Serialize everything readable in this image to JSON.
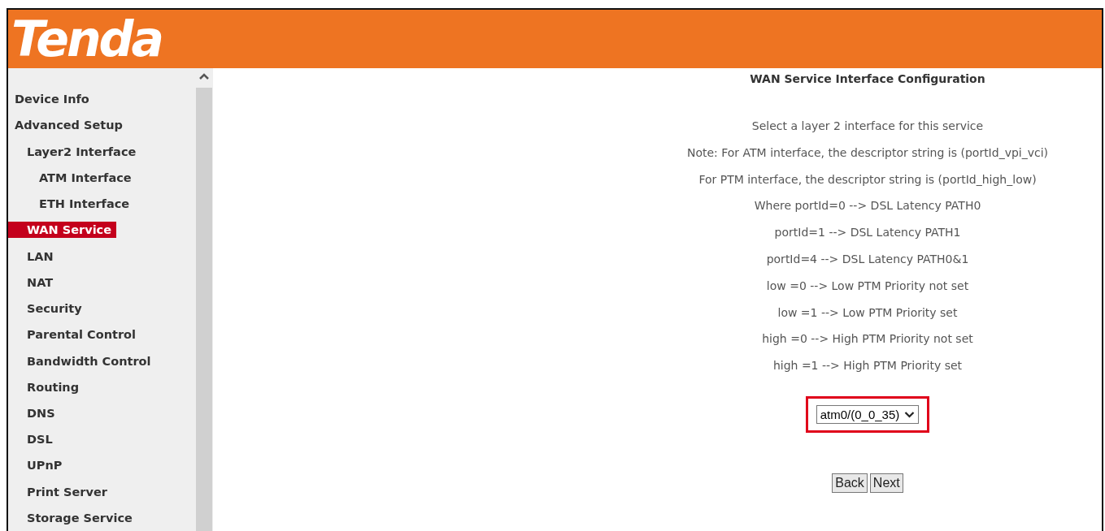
{
  "header": {
    "logo": "Tenda"
  },
  "sidebar": {
    "items": [
      {
        "label": "Device Info",
        "selected": false
      },
      {
        "label": "Advanced Setup",
        "selected": false,
        "children": [
          {
            "label": "Layer2 Interface",
            "selected": false,
            "children": [
              {
                "label": "ATM Interface",
                "selected": false
              },
              {
                "label": "ETH Interface",
                "selected": false
              }
            ]
          },
          {
            "label": "WAN Service",
            "selected": true
          },
          {
            "label": "LAN",
            "selected": false
          },
          {
            "label": "NAT",
            "selected": false
          },
          {
            "label": "Security",
            "selected": false
          },
          {
            "label": "Parental Control",
            "selected": false
          },
          {
            "label": "Bandwidth Control",
            "selected": false
          },
          {
            "label": "Routing",
            "selected": false
          },
          {
            "label": "DNS",
            "selected": false
          },
          {
            "label": "DSL",
            "selected": false
          },
          {
            "label": "UPnP",
            "selected": false
          },
          {
            "label": "Print Server",
            "selected": false
          },
          {
            "label": "Storage Service",
            "selected": false
          }
        ]
      }
    ]
  },
  "content": {
    "title": "WAN Service Interface Configuration",
    "notes": [
      "Select a layer 2 interface for this service",
      "Note: For ATM interface, the descriptor string is (portId_vpi_vci)",
      "For PTM interface, the descriptor string is (portId_high_low)",
      "Where portId=0 --> DSL Latency PATH0",
      "portId=1 --> DSL Latency PATH1",
      "portId=4 --> DSL Latency PATH0&1",
      "low =0 --> Low PTM Priority not set",
      "low =1 --> Low PTM Priority set",
      "high =0 --> High PTM Priority not set",
      "high =1 --> High PTM Priority set"
    ],
    "interface_select": {
      "value": "atm0/(0_0_35)",
      "highlighted": true
    },
    "buttons": [
      "Back",
      "Next"
    ]
  }
}
